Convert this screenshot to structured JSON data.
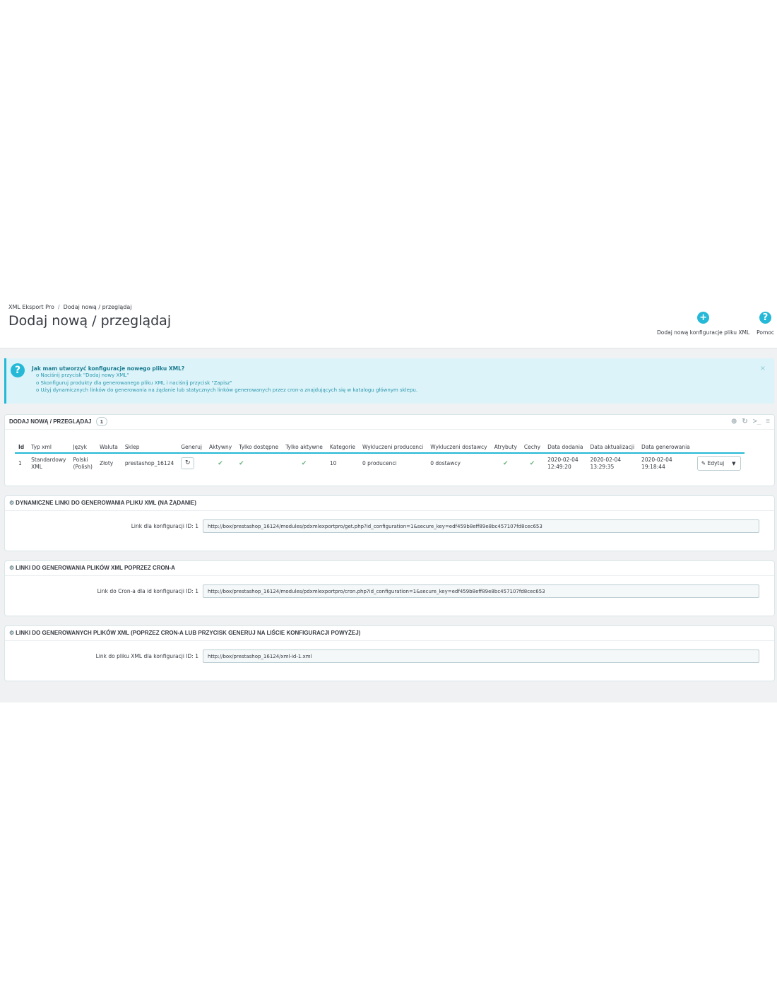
{
  "breadcrumb": {
    "root": "XML Eksport Pro",
    "current": "Dodaj nową / przeglądaj"
  },
  "page_title": "Dodaj nową / przeglądaj",
  "toolbar": {
    "add_label": "Dodaj nową konfiguracje pliku XML",
    "help_label": "Pomoc",
    "add_icon": "+",
    "help_icon": "?"
  },
  "alert": {
    "title": "Jak mam utworzyć konfiguracje nowego pliku XML?",
    "items": [
      "Naciśnij przycisk \"Dodaj nowy XML\"",
      "Skonfiguruj produkty dla generowanego pliku XML i naciśnij przycisk \"Zapisz\"",
      "Użyj dynamicznych linków do generowania na żądanie lub statycznych linków generowanych przez cron-a znajdujących się w katalogu głównym sklepu."
    ],
    "close": "×",
    "icon": "?"
  },
  "list_panel": {
    "title": "Dodaj nową / przeglądaj",
    "count": "1",
    "columns": [
      "Id",
      "Typ xml",
      "Język",
      "Waluta",
      "Sklep",
      "Generuj",
      "Aktywny",
      "Tylko dostępne",
      "Tylko aktywne",
      "Kategorie",
      "Wykluczeni producenci",
      "Wykluczeni dostawcy",
      "Atrybuty",
      "Cechy",
      "Data dodania",
      "Data aktualizacji",
      "Data generowania"
    ],
    "row": {
      "id": "1",
      "type_line1": "Standardowy",
      "type_line2": "XML",
      "lang_line1": "Polski",
      "lang_line2": "(Polish)",
      "currency": "Złoty",
      "shop": "prestashop_16124",
      "categories": "10",
      "manufacturers": "0 producenci",
      "suppliers": "0 dostawcy",
      "date_added_1": "2020-02-04",
      "date_added_2": "12:49:20",
      "date_updated_1": "2020-02-04",
      "date_updated_2": "13:29:35",
      "date_generated_1": "2020-02-04",
      "date_generated_2": "19:18:44",
      "edit_label": "Edytuj"
    }
  },
  "dynamic_panel": {
    "title": "Dynamiczne linki do generowania pliku XML (na żądanie)",
    "label": "Link dla konfiguracji ID: 1",
    "value": "http://box/prestashop_16124/modules/pdxmlexportpro/get.php?id_configuration=1&secure_key=edf459b8eff89e8bc457107fd8cec653"
  },
  "cron_panel": {
    "title": "Linki do generowania plików XML poprzez cron-a",
    "label": "Link do Cron-a dla id konfiguracji ID: 1",
    "value": "http://box/prestashop_16124/modules/pdxmlexportpro/cron.php?id_configuration=1&secure_key=edf459b8eff89e8bc457107fd8cec653"
  },
  "files_panel": {
    "title": "Linki do generowanych plików XML (poprzez cron-a lub przycisk generuj na liście konfiguracji powyżej)",
    "label": "Link do pliku XML dla konfiguracji ID: 1",
    "value": "http://box/prestashop_16124/xml-id-1.xml"
  }
}
